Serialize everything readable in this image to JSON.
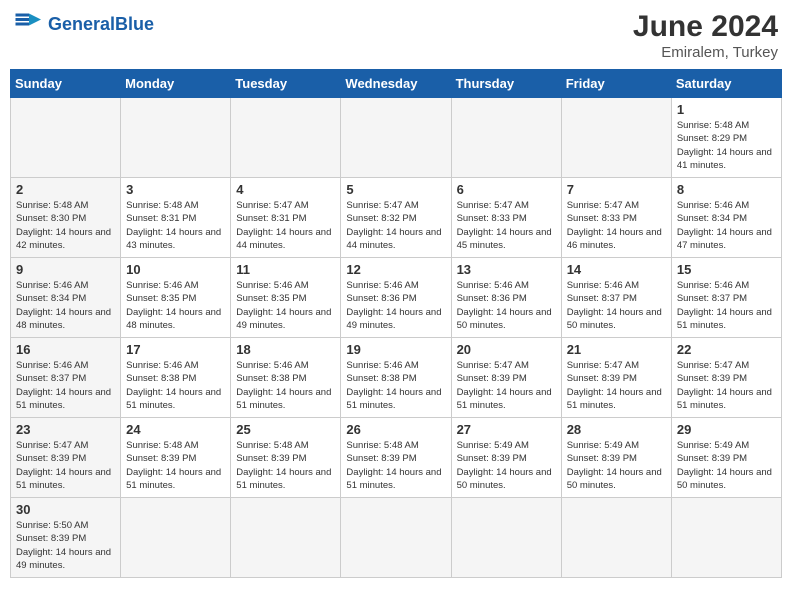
{
  "header": {
    "logo_general": "General",
    "logo_blue": "Blue",
    "title": "June 2024",
    "subtitle": "Emiralem, Turkey"
  },
  "weekdays": [
    "Sunday",
    "Monday",
    "Tuesday",
    "Wednesday",
    "Thursday",
    "Friday",
    "Saturday"
  ],
  "days": {
    "d1": {
      "num": "1",
      "sunrise": "5:48 AM",
      "sunset": "8:29 PM",
      "daylight": "14 hours and 41 minutes."
    },
    "d2": {
      "num": "2",
      "sunrise": "5:48 AM",
      "sunset": "8:30 PM",
      "daylight": "14 hours and 42 minutes."
    },
    "d3": {
      "num": "3",
      "sunrise": "5:48 AM",
      "sunset": "8:31 PM",
      "daylight": "14 hours and 43 minutes."
    },
    "d4": {
      "num": "4",
      "sunrise": "5:47 AM",
      "sunset": "8:31 PM",
      "daylight": "14 hours and 44 minutes."
    },
    "d5": {
      "num": "5",
      "sunrise": "5:47 AM",
      "sunset": "8:32 PM",
      "daylight": "14 hours and 44 minutes."
    },
    "d6": {
      "num": "6",
      "sunrise": "5:47 AM",
      "sunset": "8:33 PM",
      "daylight": "14 hours and 45 minutes."
    },
    "d7": {
      "num": "7",
      "sunrise": "5:47 AM",
      "sunset": "8:33 PM",
      "daylight": "14 hours and 46 minutes."
    },
    "d8": {
      "num": "8",
      "sunrise": "5:46 AM",
      "sunset": "8:34 PM",
      "daylight": "14 hours and 47 minutes."
    },
    "d9": {
      "num": "9",
      "sunrise": "5:46 AM",
      "sunset": "8:34 PM",
      "daylight": "14 hours and 48 minutes."
    },
    "d10": {
      "num": "10",
      "sunrise": "5:46 AM",
      "sunset": "8:35 PM",
      "daylight": "14 hours and 48 minutes."
    },
    "d11": {
      "num": "11",
      "sunrise": "5:46 AM",
      "sunset": "8:35 PM",
      "daylight": "14 hours and 49 minutes."
    },
    "d12": {
      "num": "12",
      "sunrise": "5:46 AM",
      "sunset": "8:36 PM",
      "daylight": "14 hours and 49 minutes."
    },
    "d13": {
      "num": "13",
      "sunrise": "5:46 AM",
      "sunset": "8:36 PM",
      "daylight": "14 hours and 50 minutes."
    },
    "d14": {
      "num": "14",
      "sunrise": "5:46 AM",
      "sunset": "8:37 PM",
      "daylight": "14 hours and 50 minutes."
    },
    "d15": {
      "num": "15",
      "sunrise": "5:46 AM",
      "sunset": "8:37 PM",
      "daylight": "14 hours and 51 minutes."
    },
    "d16": {
      "num": "16",
      "sunrise": "5:46 AM",
      "sunset": "8:37 PM",
      "daylight": "14 hours and 51 minutes."
    },
    "d17": {
      "num": "17",
      "sunrise": "5:46 AM",
      "sunset": "8:38 PM",
      "daylight": "14 hours and 51 minutes."
    },
    "d18": {
      "num": "18",
      "sunrise": "5:46 AM",
      "sunset": "8:38 PM",
      "daylight": "14 hours and 51 minutes."
    },
    "d19": {
      "num": "19",
      "sunrise": "5:46 AM",
      "sunset": "8:38 PM",
      "daylight": "14 hours and 51 minutes."
    },
    "d20": {
      "num": "20",
      "sunrise": "5:47 AM",
      "sunset": "8:39 PM",
      "daylight": "14 hours and 51 minutes."
    },
    "d21": {
      "num": "21",
      "sunrise": "5:47 AM",
      "sunset": "8:39 PM",
      "daylight": "14 hours and 51 minutes."
    },
    "d22": {
      "num": "22",
      "sunrise": "5:47 AM",
      "sunset": "8:39 PM",
      "daylight": "14 hours and 51 minutes."
    },
    "d23": {
      "num": "23",
      "sunrise": "5:47 AM",
      "sunset": "8:39 PM",
      "daylight": "14 hours and 51 minutes."
    },
    "d24": {
      "num": "24",
      "sunrise": "5:48 AM",
      "sunset": "8:39 PM",
      "daylight": "14 hours and 51 minutes."
    },
    "d25": {
      "num": "25",
      "sunrise": "5:48 AM",
      "sunset": "8:39 PM",
      "daylight": "14 hours and 51 minutes."
    },
    "d26": {
      "num": "26",
      "sunrise": "5:48 AM",
      "sunset": "8:39 PM",
      "daylight": "14 hours and 51 minutes."
    },
    "d27": {
      "num": "27",
      "sunrise": "5:49 AM",
      "sunset": "8:39 PM",
      "daylight": "14 hours and 50 minutes."
    },
    "d28": {
      "num": "28",
      "sunrise": "5:49 AM",
      "sunset": "8:39 PM",
      "daylight": "14 hours and 50 minutes."
    },
    "d29": {
      "num": "29",
      "sunrise": "5:49 AM",
      "sunset": "8:39 PM",
      "daylight": "14 hours and 50 minutes."
    },
    "d30": {
      "num": "30",
      "sunrise": "5:50 AM",
      "sunset": "8:39 PM",
      "daylight": "14 hours and 49 minutes."
    }
  }
}
